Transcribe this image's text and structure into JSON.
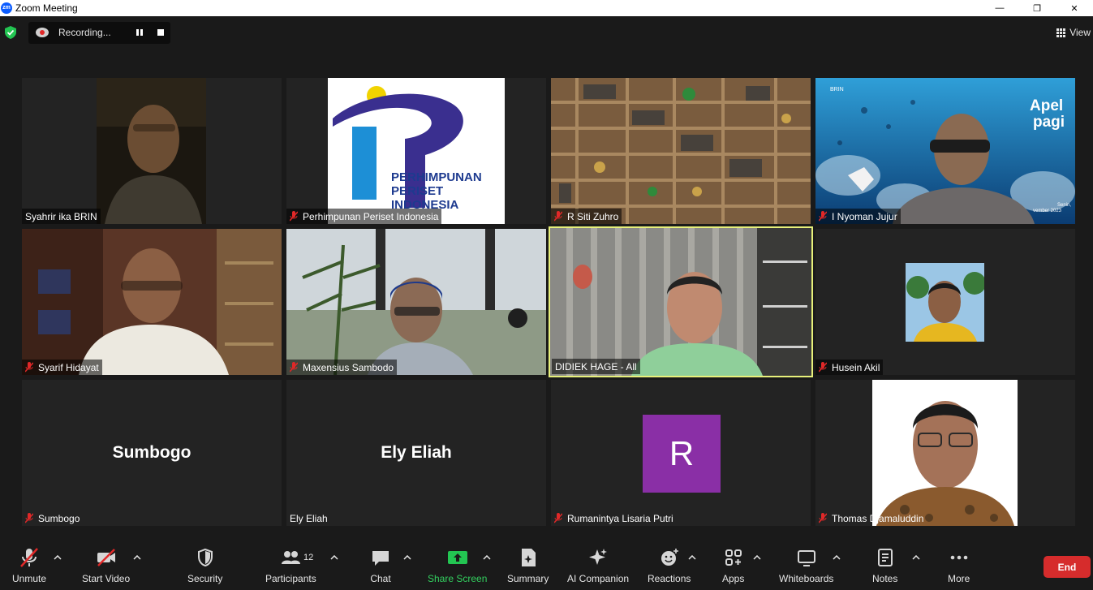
{
  "window": {
    "title": "Zoom Meeting",
    "logo": "zm",
    "minimize": "—",
    "maximize": "❐",
    "close": "✕"
  },
  "recording": {
    "label": "Recording..."
  },
  "view": {
    "label": "View"
  },
  "participants": [
    {
      "name": "Syahrir ika BRIN",
      "muted": false
    },
    {
      "name": "Perhimpunan Periset Indonesia",
      "muted": true
    },
    {
      "name": "R Siti Zuhro",
      "muted": true
    },
    {
      "name": "I Nyoman Jujur",
      "muted": true
    },
    {
      "name": "Syarif Hidayat",
      "muted": true
    },
    {
      "name": "Maxensius Sambodo",
      "muted": true
    },
    {
      "name": "DIDIEK HAGE - All",
      "muted": false
    },
    {
      "name": "Husein Akil",
      "muted": true
    },
    {
      "name": "Sumbogo",
      "muted": true,
      "display": "Sumbogo"
    },
    {
      "name": "Ely Eliah",
      "muted": false,
      "display": "Ely Eliah"
    },
    {
      "name": "Rumanintya Lisaria Putri",
      "muted": true,
      "avatar": "R"
    },
    {
      "name": "Thomas Djamaluddin",
      "muted": true
    }
  ],
  "logo_text": {
    "line1": "PERHIMPUNAN",
    "line2": "PERISET",
    "line3": "INDONESIA"
  },
  "apel": {
    "line1": "Apel",
    "line2": "pagi",
    "brand": "BRIN",
    "day": "Senin,",
    "date": "vember 2023"
  },
  "toolbar": {
    "unmute": "Unmute",
    "start_video": "Start Video",
    "security": "Security",
    "participants": "Participants",
    "participants_count": "12",
    "chat": "Chat",
    "share_screen": "Share Screen",
    "summary": "Summary",
    "ai_companion": "AI Companion",
    "reactions": "Reactions",
    "apps": "Apps",
    "whiteboards": "Whiteboards",
    "notes": "Notes",
    "more": "More",
    "end": "End"
  },
  "colors": {
    "speaker_border": "#e7f07a",
    "share_green": "#33d05f",
    "end_red": "#d62c2c",
    "avatar_purple": "#8a2fa6"
  }
}
